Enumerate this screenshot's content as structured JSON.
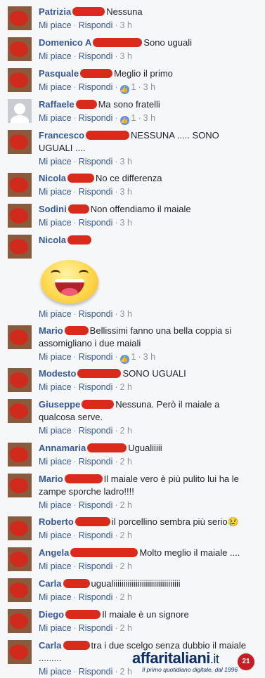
{
  "actions": {
    "like": "Mi piace",
    "reply": "Rispondi",
    "separator": "·"
  },
  "comments": [
    {
      "name": "Patrizia",
      "text": "Nessuna",
      "time": "3 h",
      "likes": ""
    },
    {
      "name": "Domenico A",
      "text": "Sono uguali",
      "time": "3 h",
      "likes": ""
    },
    {
      "name": "Pasquale",
      "text": "Meglio il primo",
      "time": "3 h",
      "likes": "1"
    },
    {
      "name": "Raffaele",
      "text": "Ma sono fratelli",
      "time": "3 h",
      "likes": "1"
    },
    {
      "name": "Francesco",
      "text": "NESSUNA ..... SONO UGUALI ....",
      "time": "3 h",
      "likes": ""
    },
    {
      "name": "Nicola",
      "text": "No ce differenza",
      "time": "3 h",
      "likes": ""
    },
    {
      "name": "Sodini",
      "text": "Non offendiamo il maiale",
      "time": "3 h",
      "likes": ""
    },
    {
      "name": "Nicola",
      "text": "",
      "time": "3 h",
      "likes": "",
      "emoji": "grinning-face"
    },
    {
      "name": "Mario",
      "text": "Bellissimi fanno una bella coppia si assomigliano i due maiali",
      "time": "3 h",
      "likes": "1"
    },
    {
      "name": "Modesto",
      "text": "SONO UGUALI",
      "time": "2 h",
      "likes": ""
    },
    {
      "name": "Giuseppe",
      "text": "Nessuna. Però il maiale a qualcosa serve.",
      "time": "2 h",
      "likes": ""
    },
    {
      "name": "Annamaria",
      "text": "Ugualiiiii",
      "time": "2 h",
      "likes": ""
    },
    {
      "name": "Mario",
      "text": "Il maiale vero è più pulito lui ha le zampe sporche ladro!!!!",
      "time": "2 h",
      "likes": ""
    },
    {
      "name": "Roberto",
      "text": "il porcellino sembra più serio😢",
      "time": "2 h",
      "likes": ""
    },
    {
      "name": "Angela",
      "text": "Molto meglio il maiale ....",
      "time": "2 h",
      "likes": ""
    },
    {
      "name": "Carla",
      "text": "ugualiiiiiiiiiiiiiiiiiiiiiiiiiiiiiiiii",
      "time": "2 h",
      "likes": ""
    },
    {
      "name": "Diego",
      "text": "Il maiale è un signore",
      "time": "2 h",
      "likes": ""
    },
    {
      "name": "Carla",
      "text": "tra i due scelgo senza dubbio il maiale .........",
      "time": "2 h",
      "likes": ""
    }
  ],
  "logo": {
    "brand": "affaritaliani",
    "tld": ".it",
    "tagline": "Il primo quotidiano digitale, dal 1996",
    "badge": "21"
  },
  "colors": {
    "name": "#365899",
    "redaction": "#d92a1b",
    "background": "#f6f7f9"
  }
}
